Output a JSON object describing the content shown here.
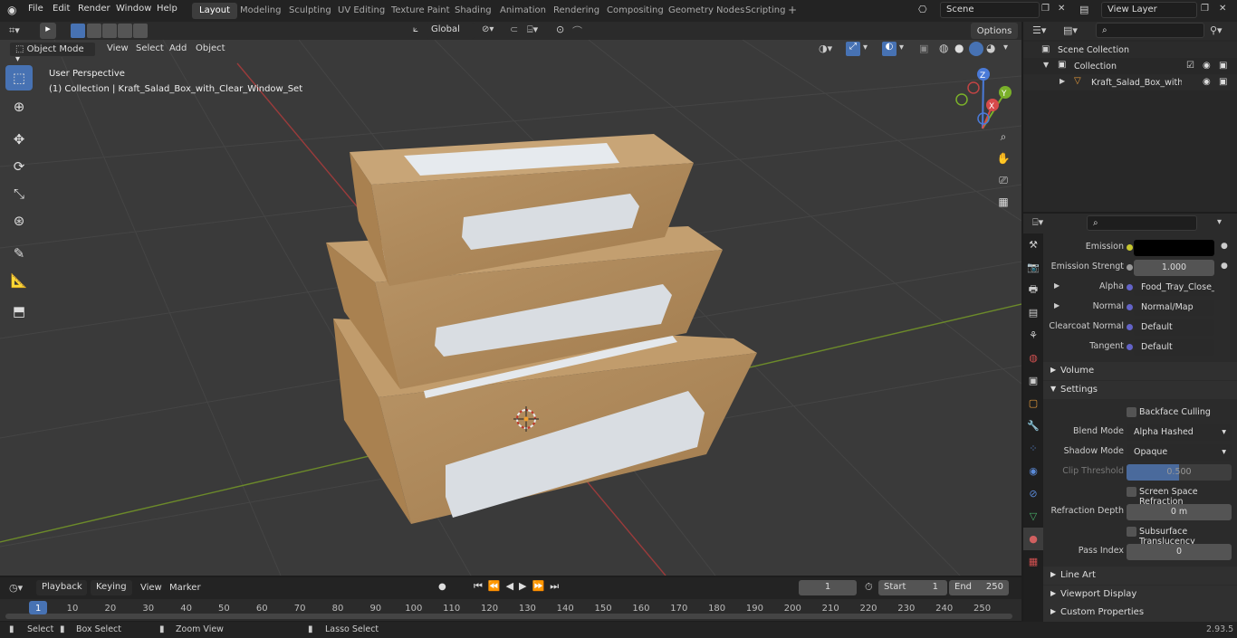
{
  "topbar": {
    "menus": [
      "File",
      "Edit",
      "Render",
      "Window",
      "Help"
    ],
    "workspaces": [
      "Layout",
      "Modeling",
      "Sculpting",
      "UV Editing",
      "Texture Paint",
      "Shading",
      "Animation",
      "Rendering",
      "Compositing",
      "Geometry Nodes",
      "Scripting"
    ],
    "active_workspace": "Layout",
    "scene": "Scene",
    "view_layer": "View Layer"
  },
  "viewport_header": {
    "mode": "Object Mode",
    "menus": [
      "View",
      "Select",
      "Add",
      "Object"
    ],
    "orientation": "Global",
    "options": "Options"
  },
  "viewport": {
    "perspective": "User Perspective",
    "collection_label": "(1) Collection | Kraft_Salad_Box_with_Clear_Window_Set",
    "gizmo": {
      "z": "Z",
      "y": "Y",
      "x": "X"
    }
  },
  "outliner": {
    "scene_collection": "Scene Collection",
    "collection": "Collection",
    "object": "Kraft_Salad_Box_with_Cl"
  },
  "properties": {
    "rows": [
      {
        "label": "Emission",
        "value": "",
        "dot": "#c7c72e",
        "color_swatch": "#000000"
      },
      {
        "label": "Emission Strengt",
        "value": "1.000",
        "dot": "#999999"
      },
      {
        "label": "Alpha",
        "value": "Food_Tray_Close_S...",
        "dot": "#6363c7",
        "expand": true
      },
      {
        "label": "Normal",
        "value": "Normal/Map",
        "dot": "#6363c7",
        "expand": true
      },
      {
        "label": "Clearcoat Normal",
        "value": "Default",
        "dot": "#6363c7"
      },
      {
        "label": "Tangent",
        "value": "Default",
        "dot": "#6363c7"
      }
    ],
    "volume": "Volume",
    "settings": "Settings",
    "backface": "Backface Culling",
    "blend_label": "Blend Mode",
    "blend_value": "Alpha Hashed",
    "shadow_label": "Shadow Mode",
    "shadow_value": "Opaque",
    "clip_label": "Clip Threshold",
    "clip_value": "0.500",
    "ssr": "Screen Space Refraction",
    "refr_label": "Refraction Depth",
    "refr_value": "0 m",
    "sss": "Subsurface Translucency",
    "pass_label": "Pass Index",
    "pass_value": "0",
    "line_art": "Line Art",
    "viewport_display": "Viewport Display",
    "custom_props": "Custom Properties"
  },
  "timeline": {
    "menus": [
      "Playback",
      "Keying",
      "View",
      "Marker"
    ],
    "current_frame": "1",
    "start_label": "Start",
    "start": "1",
    "end_label": "End",
    "end": "250",
    "ticks": [
      "1",
      "10",
      "20",
      "30",
      "40",
      "50",
      "60",
      "70",
      "80",
      "90",
      "100",
      "110",
      "120",
      "130",
      "140",
      "150",
      "160",
      "170",
      "180",
      "190",
      "200",
      "210",
      "220",
      "230",
      "240",
      "250"
    ]
  },
  "statusbar": {
    "select": "Select",
    "box_select": "Box Select",
    "zoom": "Zoom View",
    "lasso": "Lasso Select",
    "version": "2.93.5"
  },
  "colors": {
    "accent": "#4772b3",
    "kraft": "#b08a5a",
    "window": "#d9dde2"
  }
}
